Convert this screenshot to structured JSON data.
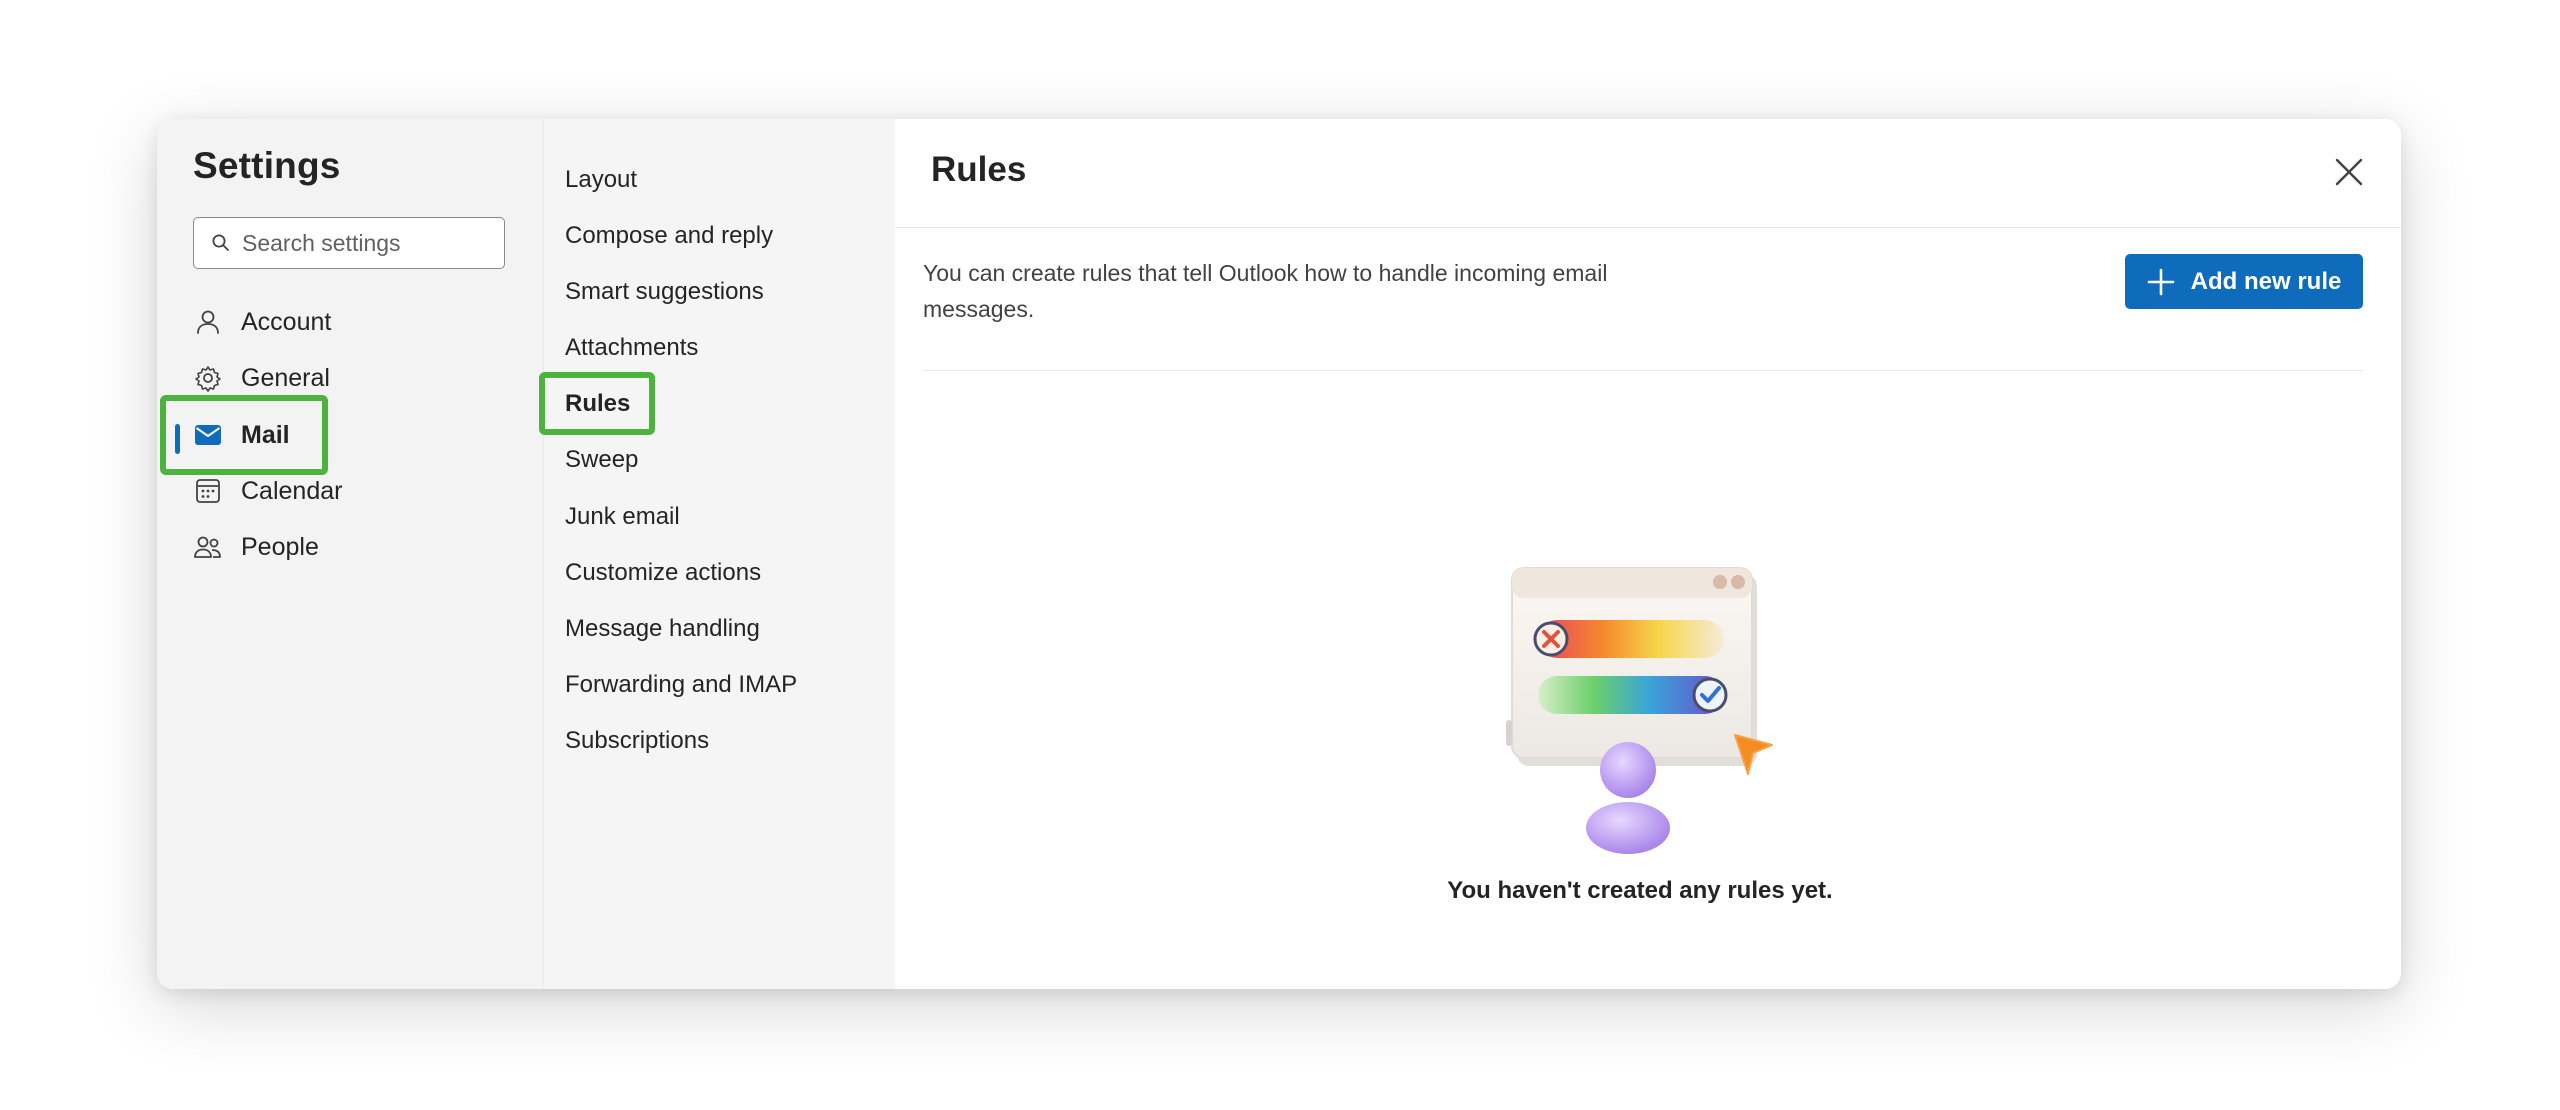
{
  "settings": {
    "title": "Settings",
    "search_placeholder": "Search settings"
  },
  "categories": [
    {
      "label": "Account",
      "icon": "person-icon"
    },
    {
      "label": "General",
      "icon": "gear-icon"
    },
    {
      "label": "Mail",
      "icon": "mail-icon",
      "selected": true
    },
    {
      "label": "Calendar",
      "icon": "calendar-icon"
    },
    {
      "label": "People",
      "icon": "people-icon"
    }
  ],
  "mail_sections": [
    {
      "label": "Layout"
    },
    {
      "label": "Compose and reply"
    },
    {
      "label": "Smart suggestions"
    },
    {
      "label": "Attachments"
    },
    {
      "label": "Rules",
      "selected": true
    },
    {
      "label": "Sweep"
    },
    {
      "label": "Junk email"
    },
    {
      "label": "Customize actions"
    },
    {
      "label": "Message handling"
    },
    {
      "label": "Forwarding and IMAP"
    },
    {
      "label": "Subscriptions"
    }
  ],
  "rules_page": {
    "title": "Rules",
    "description": "You can create rules that tell Outlook how to handle incoming email messages.",
    "add_button_label": "Add new rule",
    "empty_state_text": "You haven't created any rules yet."
  },
  "colors": {
    "accent": "#0f6cbd",
    "highlight": "#4cb43c"
  }
}
